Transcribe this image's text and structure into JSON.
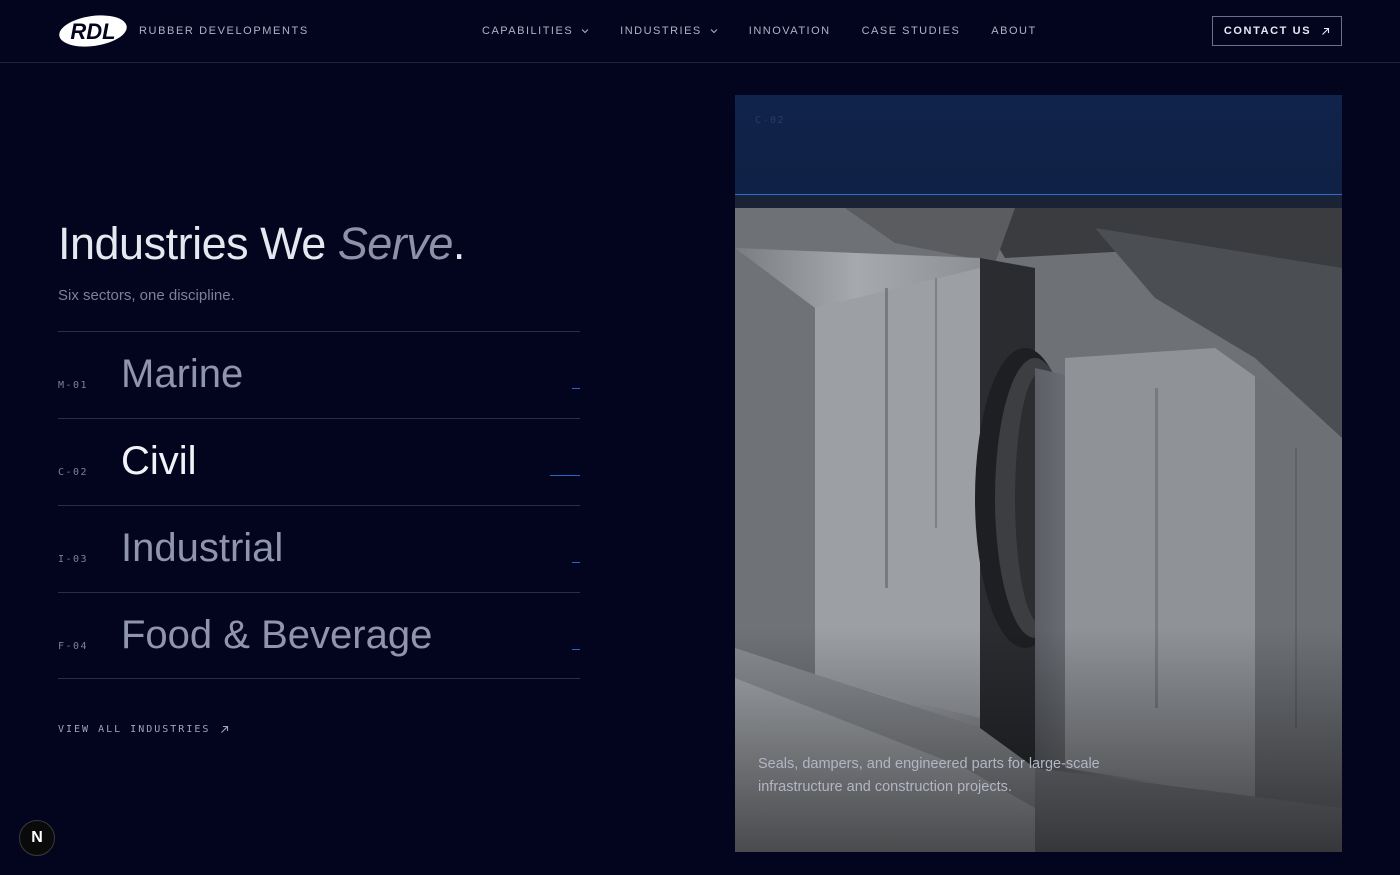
{
  "header": {
    "logo_text": "RDL",
    "brand": "RUBBER DEVELOPMENTS",
    "nav": [
      {
        "label": "CAPABILITIES",
        "dropdown": true
      },
      {
        "label": "INDUSTRIES",
        "dropdown": true
      },
      {
        "label": "INNOVATION",
        "dropdown": false
      },
      {
        "label": "CASE STUDIES",
        "dropdown": false
      },
      {
        "label": "ABOUT",
        "dropdown": false
      }
    ],
    "contact_label": "CONTACT US"
  },
  "main": {
    "title_prefix": "Industries We ",
    "title_emphasis": "Serve",
    "title_suffix": ".",
    "subtitle": "Six sectors, one discipline.",
    "industries": [
      {
        "code": "M-01",
        "name": "Marine",
        "active": false
      },
      {
        "code": "C-02",
        "name": "Civil",
        "active": true
      },
      {
        "code": "I-03",
        "name": "Industrial",
        "active": false
      },
      {
        "code": "F-04",
        "name": "Food & Beverage",
        "active": false
      }
    ],
    "view_all": "VIEW ALL INDUSTRIES"
  },
  "panel": {
    "code": "C-02",
    "caption": "Seals, dampers, and engineered parts for large-scale infrastructure and construction projects."
  },
  "badge": {
    "label": "N"
  },
  "colors": {
    "background": "#03051f",
    "accent": "#2e63c9",
    "text_active": "#f2f3f8",
    "text_muted": "#8f95ad"
  }
}
